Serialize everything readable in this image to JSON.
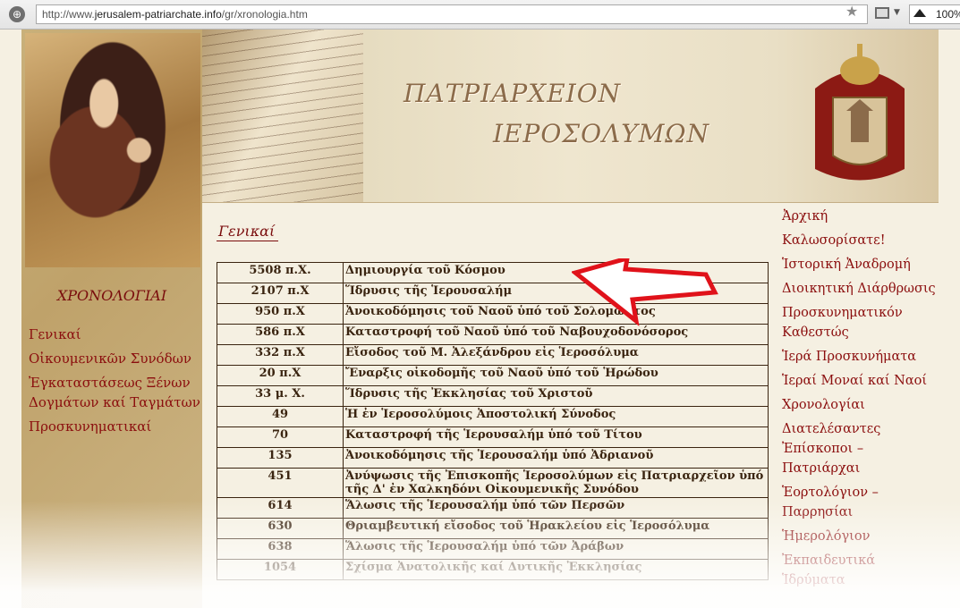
{
  "browser": {
    "url_prefix": "http://www.",
    "url_domain": "jerusalem-patriarchate.info",
    "url_path": "/gr/xronologia.htm",
    "zoom": "100%"
  },
  "banner": {
    "line1": "ΠΑΤΡΙΑΡΧΕΙΟΝ",
    "line2": "ΙΕΡΟΣΟΛΥΜΩΝ"
  },
  "left_menu": {
    "title": "ΧΡΟΝΟΛΟΓΙΑΙ",
    "items": [
      "Γενικαί",
      "Οἰκουμενικῶν Συνόδων",
      "Ἐγκαταστάσεως Ξένων",
      "Δογμάτων καί Ταγμάτων",
      "Προσκυνηματικαί"
    ]
  },
  "section_heading": "Γενικαί",
  "chronology": [
    {
      "year": "5508 π.Χ.",
      "event": "Δημιουργία τοῦ Κόσμου"
    },
    {
      "year": "2107 π.Χ",
      "event": "Ἵδρυσις τῆς Ἱερουσαλήμ"
    },
    {
      "year": "950 π.Χ",
      "event": "Ἀνοικοδόμησις τοῦ Ναοῦ ὑπό τοῦ Σολομῶντος"
    },
    {
      "year": "586 π.Χ",
      "event": "Καταστροφή τοῦ Ναοῦ ὑπό τοῦ Ναβουχοδονόσορος"
    },
    {
      "year": "332 π.Χ",
      "event": "Εἴσοδος τοῦ Μ. Ἀλεξάνδρου εἰς Ἱεροσόλυμα"
    },
    {
      "year": "20 π.Χ",
      "event": "Ἔναρξις οἰκοδομῆς τοῦ Ναοῦ ὑπό τοῦ Ἡρώδου"
    },
    {
      "year": "33 μ. Χ.",
      "event": "Ἵδρυσις τῆς Ἐκκλησίας τοῦ Χριστοῦ"
    },
    {
      "year": "49",
      "event": "Ἡ ἐν Ἱεροσολύμοις Ἀποστολική Σύνοδος"
    },
    {
      "year": "70",
      "event": "Καταστροφή τῆς Ἱερουσαλήμ ὑπό τοῦ Τίτου"
    },
    {
      "year": "135",
      "event": "Ἀνοικοδόμησις τῆς Ἱερουσαλήμ ὑπό Ἀδριανοῦ"
    },
    {
      "year": "451",
      "event": "Ἀνύψωσις τῆς Ἐπισκοπῆς Ἱεροσολύμων εἰς Πατριαρχεῖον ὑπό τῆς Δ' ἐν Χαλκηδόνι Οἰκουμενικῆς Συνόδου"
    },
    {
      "year": "614",
      "event": "Ἅλωσις τῆς Ἱερουσαλήμ ὑπό τῶν Περσῶν"
    },
    {
      "year": "630",
      "event": "Θριαμβευτική εἴσοδος τοῦ Ἡρακλείου εἰς Ἱεροσόλυμα"
    },
    {
      "year": "638",
      "event": "Ἅλωσις τῆς Ἱερουσαλήμ ὑπό τῶν Ἀράβων"
    },
    {
      "year": "1054",
      "event": "Σχίσμα Ἀνατολικῆς καί Δυτικῆς Ἐκκλησίας"
    }
  ],
  "right_menu": [
    "Ἀρχική",
    "Καλωσορίσατε!",
    "Ἱστορική Ἀναδρομή",
    "Διοικητική Διάρθρωσις",
    "Προσκυνηματικόν Καθεστώς",
    "Ἱερά Προσκυνήματα",
    "Ἱεραί Μοναί καί Ναοί",
    "Χρονολογίαι",
    "Διατελέσαντες Ἐπίσκοποι – Πατριάρχαι",
    "Ἑορτολόγιον – Παρρησίαι",
    "Ἡμερολόγιον",
    "Ἐκπαιδευτικά Ἱδρύματα"
  ],
  "colors": {
    "link": "#8b0e0e",
    "table_text": "#3a2410",
    "arrow": "#e0121a"
  }
}
